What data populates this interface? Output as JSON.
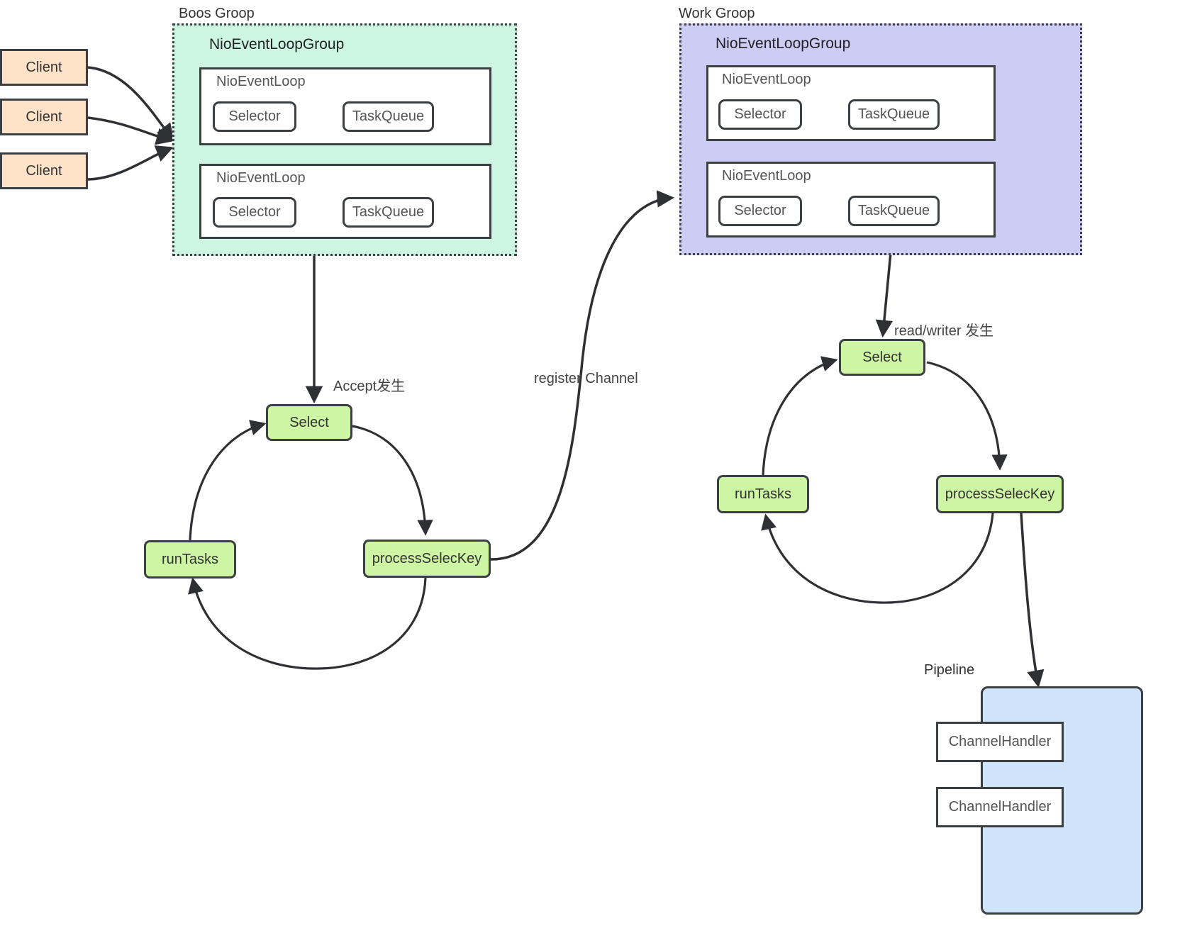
{
  "diagram": {
    "title": "Netty NioEventLoopGroup architecture",
    "colors": {
      "boss_group_fill": "#ccf5e2",
      "work_group_fill": "#ccccf5",
      "client_fill": "#ffe3c8",
      "green_node_fill": "#cdf5a3",
      "pipeline_fill": "#cfe3fa",
      "stroke": "#3c4043"
    }
  },
  "clients": [
    {
      "label": "Client"
    },
    {
      "label": "Client"
    },
    {
      "label": "Client"
    }
  ],
  "boss_group": {
    "caption": "Boos Groop",
    "title": "NioEventLoopGroup",
    "event_loops": [
      {
        "label": "NioEventLoop",
        "selector": "Selector",
        "taskqueue": "TaskQueue"
      },
      {
        "label": "NioEventLoop",
        "selector": "Selector",
        "taskqueue": "TaskQueue"
      }
    ]
  },
  "work_group": {
    "caption": "Work Groop",
    "title": "NioEventLoopGroup",
    "event_loops": [
      {
        "label": "NioEventLoop",
        "selector": "Selector",
        "taskqueue": "TaskQueue"
      },
      {
        "label": "NioEventLoop",
        "selector": "Selector",
        "taskqueue": "TaskQueue"
      }
    ]
  },
  "boss_cycle": {
    "select": "Select",
    "process": "processSelecKey",
    "runtasks": "runTasks",
    "trigger_label": "Accept发生"
  },
  "work_cycle": {
    "select": "Select",
    "process": "processSelecKey",
    "runtasks": "runTasks",
    "trigger_label": "read/writer 发生"
  },
  "edges": {
    "register_channel": "register Channel"
  },
  "pipeline": {
    "caption": "Pipeline",
    "handlers": [
      {
        "label": "ChannelHandler"
      },
      {
        "label": "ChannelHandler"
      }
    ]
  }
}
